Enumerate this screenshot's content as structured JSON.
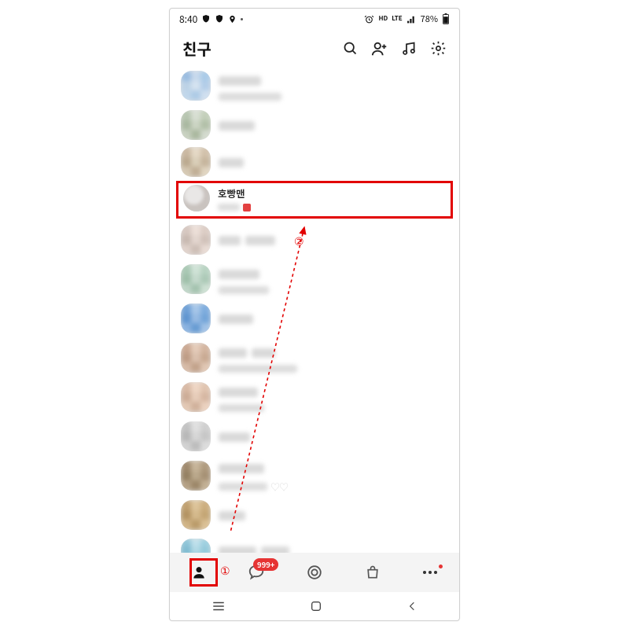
{
  "status": {
    "time": "8:40",
    "hd": "HD",
    "lte": "LTE",
    "volte_sub": "៖៖",
    "battery": "78%"
  },
  "header": {
    "title": "친구"
  },
  "highlighted_friend": {
    "name": "호빵맨"
  },
  "annotations": {
    "n1": "①",
    "n2": "②"
  },
  "tabbar": {
    "chat_badge": "999+"
  },
  "colors": {
    "accent_hl": "#e20000",
    "badge": "#e63434"
  }
}
